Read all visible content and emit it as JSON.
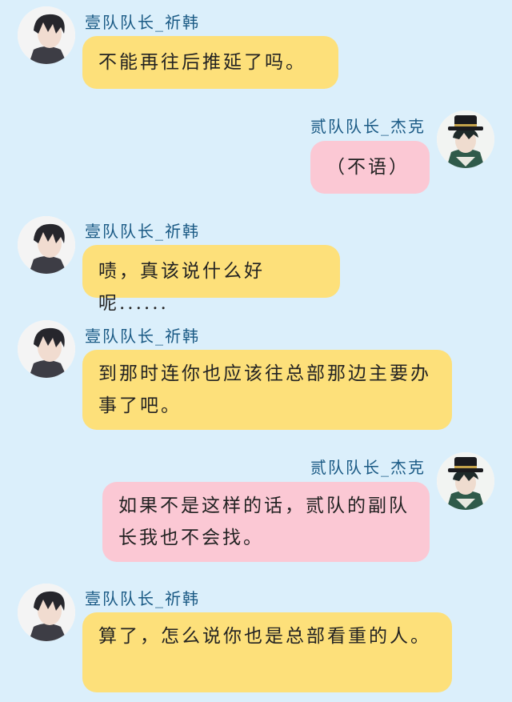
{
  "theme": {
    "background": "#dbeffb",
    "left_bubble": "#fde07a",
    "right_bubble": "#fbc8d4",
    "name_color": "#1a5a85"
  },
  "messages": [
    {
      "side": "left",
      "sender": "壹队队长_祈韩",
      "avatar": "qihan-avatar",
      "text": "不能再往后推延了吗。"
    },
    {
      "side": "right",
      "sender": "贰队队长_杰克",
      "avatar": "jack-avatar",
      "text": "（不语）"
    },
    {
      "side": "left",
      "sender": "壹队队长_祈韩",
      "avatar": "qihan-avatar",
      "text": "啧，真该说什么好呢......"
    },
    {
      "side": "left",
      "sender": "壹队队长_祈韩",
      "avatar": "qihan-avatar",
      "text": "到那时连你也应该往总部那边主要办事了吧。"
    },
    {
      "side": "right",
      "sender": "贰队队长_杰克",
      "avatar": "jack-avatar",
      "text": "如果不是这样的话，贰队的副队长我也不会找。"
    },
    {
      "side": "left",
      "sender": "壹队队长_祈韩",
      "avatar": "qihan-avatar",
      "text": "算了，怎么说你也是总部看重的人。"
    }
  ]
}
